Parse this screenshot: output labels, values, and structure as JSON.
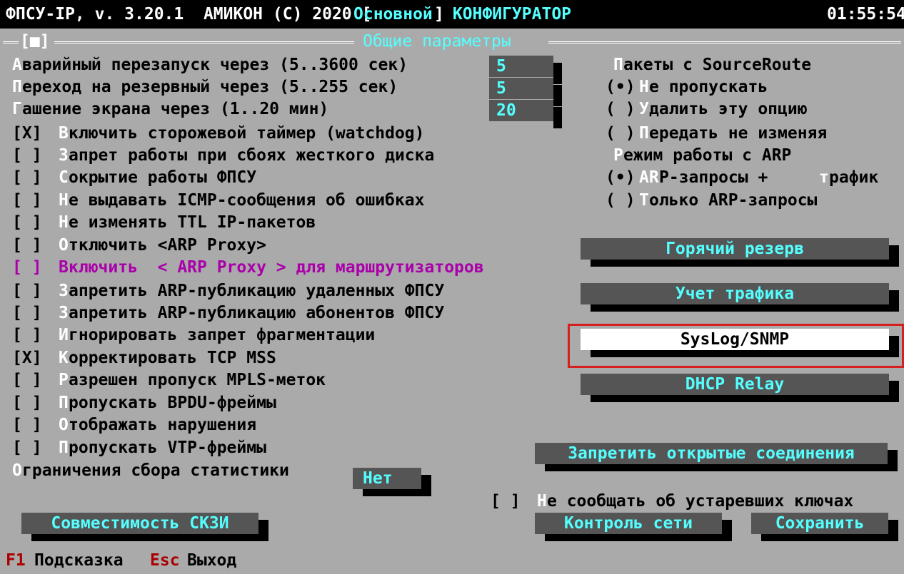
{
  "title_bar": {
    "prefix": "ФПСУ-IP, v. 3.20.1  АМИКОН (C) 2020 [",
    "mode": "Основной",
    "bracket": "]",
    "app": " КОНФИГУРАТОР",
    "time": "01:55:54"
  },
  "panel": {
    "marker": "[■]",
    "title": "Общие параметры"
  },
  "params": [
    {
      "hot": "А",
      "rest": "варийный перезапуск через (5..3600 сек)",
      "value": "5"
    },
    {
      "hot": "П",
      "rest": "ереход на резервный через (5..255 сек)",
      "value": "5"
    },
    {
      "hot": "Г",
      "rest": "ашение экрана через (1..20 мин)",
      "value": "20"
    }
  ],
  "checkboxes": [
    {
      "box": "[X]",
      "hot": "В",
      "rest": "ключить сторожевой таймер (watchdog)"
    },
    {
      "box": "[ ]",
      "hot": "З",
      "rest": "апрет работы при сбоях жесткого диска"
    },
    {
      "box": "[ ]",
      "hot": "С",
      "rest": "окрытие работы ФПСУ"
    },
    {
      "box": "[ ]",
      "hot": "Н",
      "rest": "е выдавать ICMP-сообщения об ошибках"
    },
    {
      "box": "[ ]",
      "hot": "Н",
      "rest": "е изменять TTL IP-пакетов"
    },
    {
      "box": "[ ]",
      "hot": "О",
      "rest": "тключить <ARP Proxy>"
    },
    {
      "box": "[ ]",
      "hot": "В",
      "rest": "ключить  < ARP Proxy > для маршрутизаторов"
    },
    {
      "box": "[ ]",
      "hot": "З",
      "rest": "апретить ARP-публикацию удаленных ФПСУ"
    },
    {
      "box": "[ ]",
      "hot": "З",
      "rest": "апретить ARP-публикацию абонентов ФПСУ"
    },
    {
      "box": "[ ]",
      "hot": "И",
      "rest": "гнорировать запрет фрагментации"
    },
    {
      "box": "[X]",
      "hot": "К",
      "rest": "орректировать TCP MSS"
    },
    {
      "box": "[ ]",
      "hot": "Р",
      "rest": "азрешен пропуск MPLS-меток"
    },
    {
      "box": "[ ]",
      "hot": "П",
      "rest": "ропускать BPDU-фреймы"
    },
    {
      "box": "[ ]",
      "hot": "О",
      "rest": "тображать нарушения"
    },
    {
      "box": "[ ]",
      "hot": "П",
      "rest": "ропускать VTP-фреймы"
    }
  ],
  "stats_limit": {
    "hot": "О",
    "rest": "граничения сбора статистики",
    "value": "Нет"
  },
  "source_route": {
    "hot": "П",
    "rest": "акеты с SourceRoute",
    "options": [
      {
        "mark": "(•)",
        "hot": "Н",
        "rest": "е пропускать"
      },
      {
        "mark": "( )",
        "hot": "У",
        "rest": "далить эту опцию"
      },
      {
        "mark": "( )",
        "hot": "П",
        "rest": "ередать не изменяя"
      }
    ]
  },
  "arp_mode": {
    "hot": "Р",
    "rest": "ежим работы с ARP",
    "options": [
      {
        "mark": "(•)",
        "hot": "AR",
        "rest1": "P-запросы + ",
        "hot2": "т",
        "rest2": "рафик"
      },
      {
        "mark": "( )",
        "hot": "Т",
        "rest": "олько ARP-запросы"
      }
    ]
  },
  "buttons": {
    "hot_reserve": "Горячий резерв",
    "traffic": "Учет трафика",
    "syslog": "SysLog/SNMP",
    "dhcp": "DHCP Relay",
    "deny_open": "Запретить открытые соединения",
    "compat": "Совместимость СКЗИ",
    "netctl": "Контроль сети",
    "save": "Сохранить"
  },
  "old_keys": {
    "box": "[ ]",
    "hot": "Н",
    "rest": "е сообщать об устаревших ключах"
  },
  "status_bar": {
    "f1_key": "F1",
    "f1_label": "Подсказка",
    "esc_key": "Esc",
    "esc_label": "Выход"
  },
  "colors": {
    "bg": "#aaaaaa",
    "field": "#555555",
    "accent": "#55ffff",
    "hotkey": "#ffffff",
    "highlight_option": "#aa00aa",
    "selection_outline": "#d62020",
    "key_red": "#aa0000"
  }
}
